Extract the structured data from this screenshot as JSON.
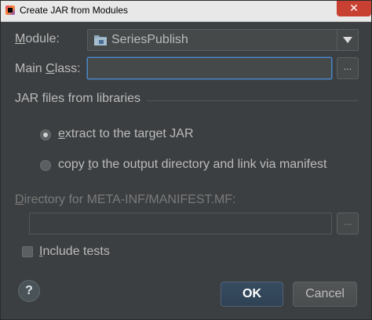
{
  "titlebar": {
    "title": "Create JAR from Modules",
    "close_glyph": "✕",
    "app_icon": "intellij-app-icon"
  },
  "module": {
    "label_pre": "",
    "label_mn": "M",
    "label_post": "odule:",
    "value": "SeriesPublish",
    "icon": "module-folder-icon"
  },
  "main_class": {
    "label_pre": "Main ",
    "label_mn": "C",
    "label_post": "lass:",
    "value": "",
    "browse_label": "..."
  },
  "jar_files": {
    "group_title": "JAR files from libraries",
    "option_extract": {
      "label_pre": "",
      "label_mn": "e",
      "label_post": "xtract to the target JAR",
      "checked": true
    },
    "option_copy": {
      "label_pre": "copy ",
      "label_mn": "t",
      "label_post": "o the output directory and link via manifest",
      "checked": false
    }
  },
  "manifest": {
    "label_mn": "D",
    "label_post": "irectory for META-INF/MANIFEST.MF:",
    "value": "",
    "browse_label": "...",
    "enabled": false
  },
  "include_tests": {
    "label_mn": "I",
    "label_post": "nclude tests",
    "checked": false
  },
  "footer": {
    "help_label": "?",
    "ok_label": "OK",
    "cancel_label": "Cancel"
  },
  "colors": {
    "background": "#3c3f41",
    "text": "#bbbbbb",
    "focus_border": "#4a88c7",
    "close_button": "#c84031"
  }
}
